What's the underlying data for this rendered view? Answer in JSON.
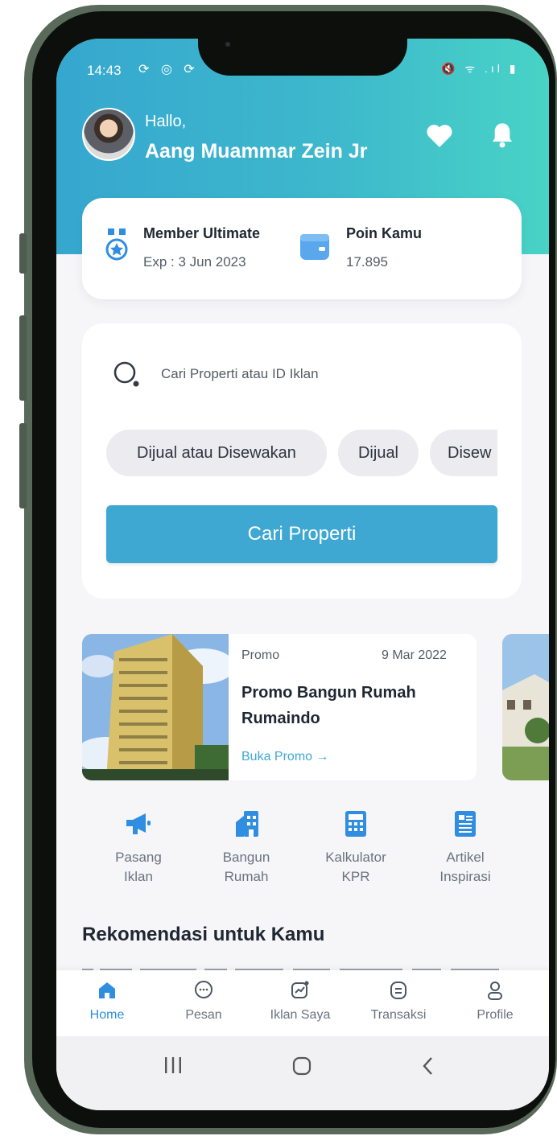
{
  "status_bar": {
    "time": "14:43",
    "left_icons": "⟳ ◎ ⟳",
    "right_icons": "🔇 ᯤ .ıl ▮"
  },
  "header": {
    "greeting": "Hallo,",
    "user_name": "Aang Muammar Zein Jr"
  },
  "member_card": {
    "title": "Member Ultimate",
    "subtitle": "Exp : 3 Jun 2023"
  },
  "points_card": {
    "title": "Poin Kamu",
    "value": "17.895"
  },
  "search": {
    "placeholder": "Cari Properti atau ID Iklan"
  },
  "filters": [
    "Dijual atau Disewakan",
    "Dijual",
    "Disew"
  ],
  "search_button": "Cari Properti",
  "promo": {
    "tag": "Promo",
    "date": "9 Mar 2022",
    "title_line1": "Promo Bangun Rumah",
    "title_line2": "Rumaindo",
    "link": "Buka Promo"
  },
  "quick_menu": [
    {
      "line1": "Pasang",
      "line2": "Iklan",
      "icon": "megaphone-icon"
    },
    {
      "line1": "Bangun",
      "line2": "Rumah",
      "icon": "building-icon"
    },
    {
      "line1": "Kalkulator",
      "line2": "KPR",
      "icon": "calculator-icon"
    },
    {
      "line1": "Artikel",
      "line2": "Inspirasi",
      "icon": "article-icon"
    }
  ],
  "section_title": "Rekomendasi untuk Kamu",
  "bottom_nav": [
    {
      "label": "Home",
      "icon": "home-icon",
      "active": true
    },
    {
      "label": "Pesan",
      "icon": "chat-icon",
      "active": false
    },
    {
      "label": "Iklan Saya",
      "icon": "chart-icon",
      "active": false
    },
    {
      "label": "Transaksi",
      "icon": "receipt-icon",
      "active": false
    },
    {
      "label": "Profile",
      "icon": "user-icon",
      "active": false
    }
  ],
  "colors": {
    "accent": "#3ea8d2",
    "header_start": "#36a7cf",
    "header_end": "#48d3c6",
    "icon_blue": "#2f8ee0",
    "link": "#3ea8d2"
  }
}
